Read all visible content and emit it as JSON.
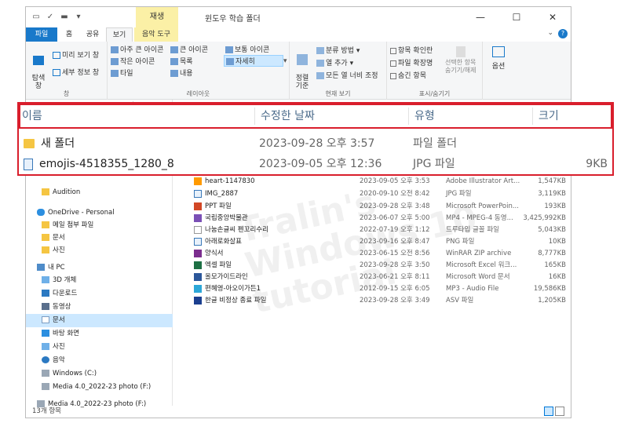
{
  "titlebar": {
    "contextual_label": "재생",
    "title": "윈도우 학습 폴더",
    "minimize": "—",
    "maximize": "☐",
    "close": "✕"
  },
  "ribbon_tabs": [
    "파일",
    "홈",
    "공유",
    "보기",
    "음악 도구"
  ],
  "ribbon": {
    "panes_group": {
      "nav_pane": "탐색\n창",
      "preview_pane": "미리 보기 창",
      "details_pane": "세부 정보 창",
      "label": "창"
    },
    "layout_group": {
      "items": [
        "아주 큰 아이콘",
        "큰 아이콘",
        "보통 아이콘",
        "작은 아이콘",
        "목록",
        "자세히",
        "타일",
        "내용"
      ],
      "label": "레이아웃"
    },
    "current_view_group": {
      "sort_by": "정렬\n기준",
      "group_by": "분류 방법",
      "add_columns": "열 추가",
      "size_all_columns": "모든 열 너비 조정",
      "label": "현재 보기"
    },
    "show_hide_group": {
      "item_checkboxes": "항목 확인란",
      "file_extensions": "파일 확장명",
      "hidden_items": "숨긴 항목",
      "hide_selected": "선택한 항목\n숨기기/해제",
      "label": "표시/숨기기"
    },
    "options": "옵션"
  },
  "nav_pane": {
    "items": [
      {
        "label": "Audition",
        "icon": "folder-icon"
      },
      {
        "label": "OneDrive - Personal",
        "icon": "cloud-icon"
      },
      {
        "label": "메일 첨부 파일",
        "icon": "folder-icon"
      },
      {
        "label": "문서",
        "icon": "folder-icon"
      },
      {
        "label": "사진",
        "icon": "folder-icon"
      },
      {
        "label": "내 PC",
        "icon": "pc-icon"
      },
      {
        "label": "3D 개체",
        "icon": "3d-icon"
      },
      {
        "label": "다운로드",
        "icon": "download-icon"
      },
      {
        "label": "동영상",
        "icon": "video-icon"
      },
      {
        "label": "문서",
        "icon": "document-icon"
      },
      {
        "label": "바탕 화면",
        "icon": "desktop-icon"
      },
      {
        "label": "사진",
        "icon": "picture-icon"
      },
      {
        "label": "음악",
        "icon": "music-icon"
      },
      {
        "label": "Windows (C:)",
        "icon": "drive-icon"
      },
      {
        "label": "Media 4.0_2022-23 photo (F:)",
        "icon": "drive-icon"
      },
      {
        "label": "Media 4.0_2022-23 photo (F:)",
        "icon": "drive-icon"
      }
    ]
  },
  "files": [
    {
      "name": "heart-1147830",
      "date": "2023-09-05 오후 3:53",
      "type": "Adobe Illustrator Art...",
      "size": "1,547KB",
      "icon": "ai-file-icon"
    },
    {
      "name": "IMG_2887",
      "date": "2020-09-10 오전 8:42",
      "type": "JPG 파일",
      "size": "3,119KB",
      "icon": "image-file-icon"
    },
    {
      "name": "PPT 파일",
      "date": "2023-09-28 오후 3:48",
      "type": "Microsoft PowerPoin...",
      "size": "193KB",
      "icon": "powerpoint-file-icon"
    },
    {
      "name": "국립중앙박물관",
      "date": "2023-06-07 오후 5:00",
      "type": "MP4 - MPEG-4 동영...",
      "size": "3,425,992KB",
      "icon": "video-file-icon"
    },
    {
      "name": "나눔손글씨 펜꼬리수리",
      "date": "2022-07-19 오후 1:12",
      "type": "트루타입 글꼴 파일",
      "size": "5,043KB",
      "icon": "font-file-icon"
    },
    {
      "name": "아래로화살표",
      "date": "2023-09-16 오후 8:47",
      "type": "PNG 파일",
      "size": "10KB",
      "icon": "image-file-icon"
    },
    {
      "name": "양식서",
      "date": "2023-06-15 오전 8:56",
      "type": "WinRAR ZIP archive",
      "size": "8,777KB",
      "icon": "zip-file-icon"
    },
    {
      "name": "엑셀 파일",
      "date": "2023-09-28 오후 3:50",
      "type": "Microsoft Excel 워크...",
      "size": "165KB",
      "icon": "excel-file-icon"
    },
    {
      "name": "올모가이드라인",
      "date": "2023-06-21 오후 8:11",
      "type": "Microsoft Word 문서",
      "size": "16KB",
      "icon": "word-file-icon"
    },
    {
      "name": "편혜영-아오이가든1",
      "date": "2012-09-15 오후 6:05",
      "type": "MP3 - Audio File",
      "size": "19,586KB",
      "icon": "audio-file-icon"
    },
    {
      "name": "한글 비정상 종료 파일",
      "date": "2023-09-28 오후 3:49",
      "type": "ASV 파일",
      "size": "1,205KB",
      "icon": "asv-file-icon"
    }
  ],
  "status": {
    "count": "13개 항목"
  },
  "watermark": {
    "line1": "Tralin's",
    "line2": "Windows 10",
    "line3": "tutorial"
  },
  "callout": {
    "headers": {
      "name": "이름",
      "date": "수정한 날짜",
      "type": "유형",
      "size": "크기"
    },
    "rows": [
      {
        "name": "새 폴더",
        "date": "2023-09-28 오후 3:57",
        "type": "파일 폴더",
        "size": "",
        "icon": "folder-icon"
      },
      {
        "name": "emojis-4518355_1280_8",
        "date": "2023-09-05 오후 12:36",
        "type": "JPG 파일",
        "size": "9KB",
        "icon": "jpg-file-icon"
      }
    ]
  },
  "colors": {
    "accent": "#1979ca",
    "callout_border": "#d91e2c",
    "contextual_tab": "#fbf0a6",
    "selection": "#cce8ff"
  }
}
